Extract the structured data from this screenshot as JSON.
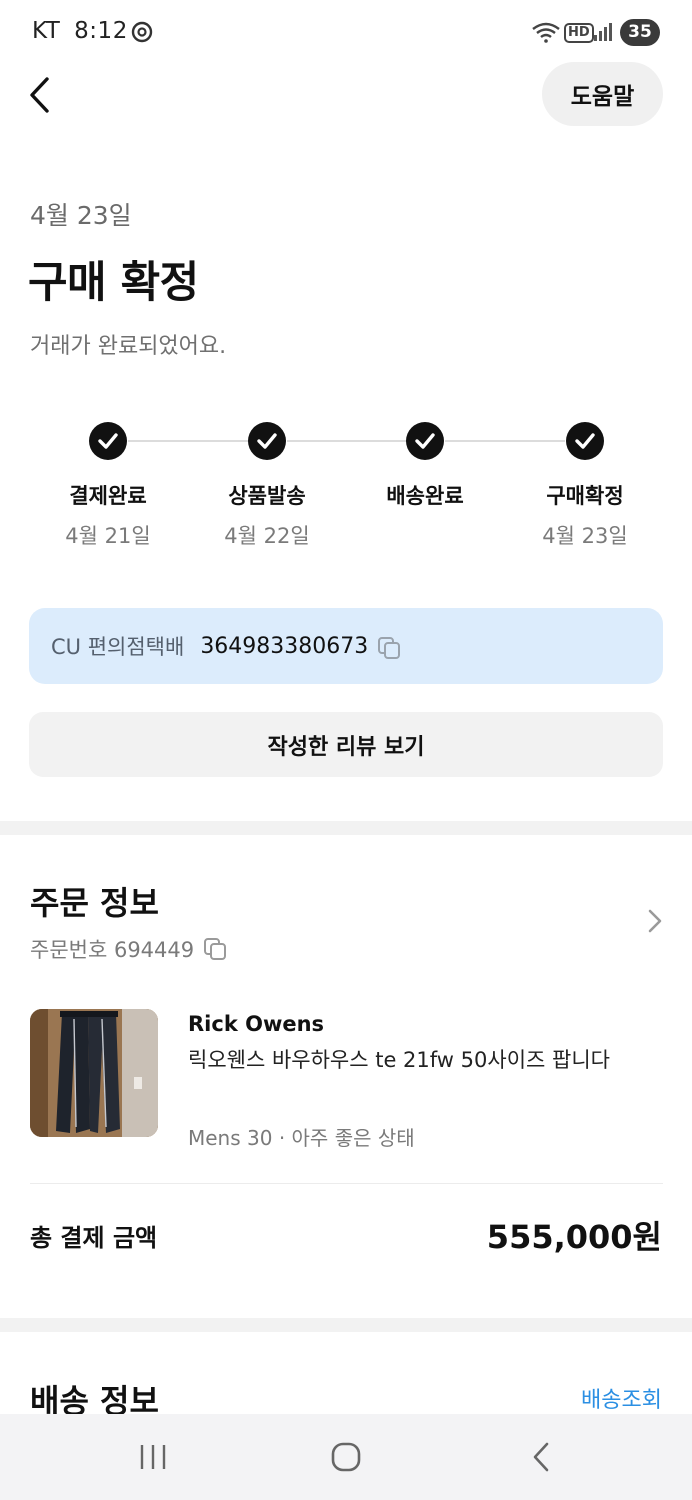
{
  "status_bar": {
    "carrier": "KT",
    "time": "8:12",
    "hd": "HD",
    "battery": "35"
  },
  "header": {
    "help_label": "도움말"
  },
  "order_status": {
    "date": "4월 23일",
    "title": "구매 확정",
    "subtitle": "거래가 완료되었어요."
  },
  "steps": [
    {
      "label": "결제완료",
      "date": "4월 21일"
    },
    {
      "label": "상품발송",
      "date": "4월 22일"
    },
    {
      "label": "배송완료",
      "date": ""
    },
    {
      "label": "구매확정",
      "date": "4월 23일"
    }
  ],
  "tracking": {
    "carrier": "CU 편의점택배",
    "number": "364983380673"
  },
  "review_button": "작성한 리뷰 보기",
  "order_info": {
    "title": "주문 정보",
    "order_number_label": "주문번호 694449",
    "brand": "Rick Owens",
    "product_name": "릭오웬스 바우하우스 te 21fw 50사이즈 팝니다",
    "meta": "Mens 30 · 아주 좋은 상태",
    "total_label": "총 결제 금액",
    "total_amount": "555,000원"
  },
  "shipping_info": {
    "title": "배송 정보",
    "track_link": "배송조회"
  },
  "colors": {
    "accent": "#2b8fe3",
    "tracking_bg": "#dcecfc",
    "button_bg": "#f2f2f2",
    "text_primary": "#111111",
    "text_secondary": "#7a7a7a"
  }
}
